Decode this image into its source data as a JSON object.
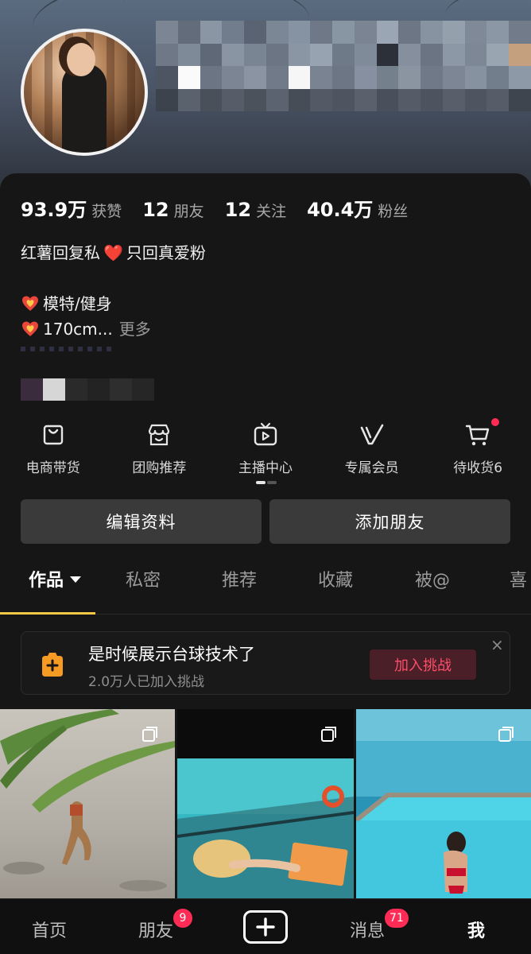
{
  "stats": [
    {
      "value": "93.9万",
      "label": "获赞"
    },
    {
      "value": "12",
      "label": "朋友"
    },
    {
      "value": "12",
      "label": "关注"
    },
    {
      "value": "40.4万",
      "label": "粉丝"
    }
  ],
  "bio": {
    "line1_before": "红薯回复私",
    "heart": "❤️",
    "line1_after": "只回真爱粉",
    "line2": "模特/健身",
    "line3": "170cm...",
    "more": "更多"
  },
  "tools": [
    {
      "label": "电商带货",
      "icon": "shopping-bag-icon"
    },
    {
      "label": "团购推荐",
      "icon": "storefront-icon"
    },
    {
      "label": "主播中心",
      "icon": "tv-play-icon"
    },
    {
      "label": "专属会员",
      "icon": "v-member-icon"
    },
    {
      "label": "待收货6",
      "icon": "cart-icon",
      "has_dot": true
    }
  ],
  "buttons": {
    "edit_profile": "编辑资料",
    "add_friend": "添加朋友"
  },
  "tabs": [
    "作品",
    "私密",
    "推荐",
    "收藏",
    "被@",
    "喜"
  ],
  "active_tab": "作品",
  "challenge": {
    "title": "是时候展示台球技术了",
    "subtitle": "2.0万人已加入挑战",
    "join_label": "加入挑战",
    "close": "×"
  },
  "bottom_nav": {
    "home": "首页",
    "friends": "朋友",
    "friends_badge": "9",
    "messages": "消息",
    "messages_badge": "71",
    "me": "我"
  },
  "colors": {
    "accent_yellow": "#f4c845",
    "brand_red": "#fe2c55",
    "challenge_orange": "#f59a23"
  }
}
